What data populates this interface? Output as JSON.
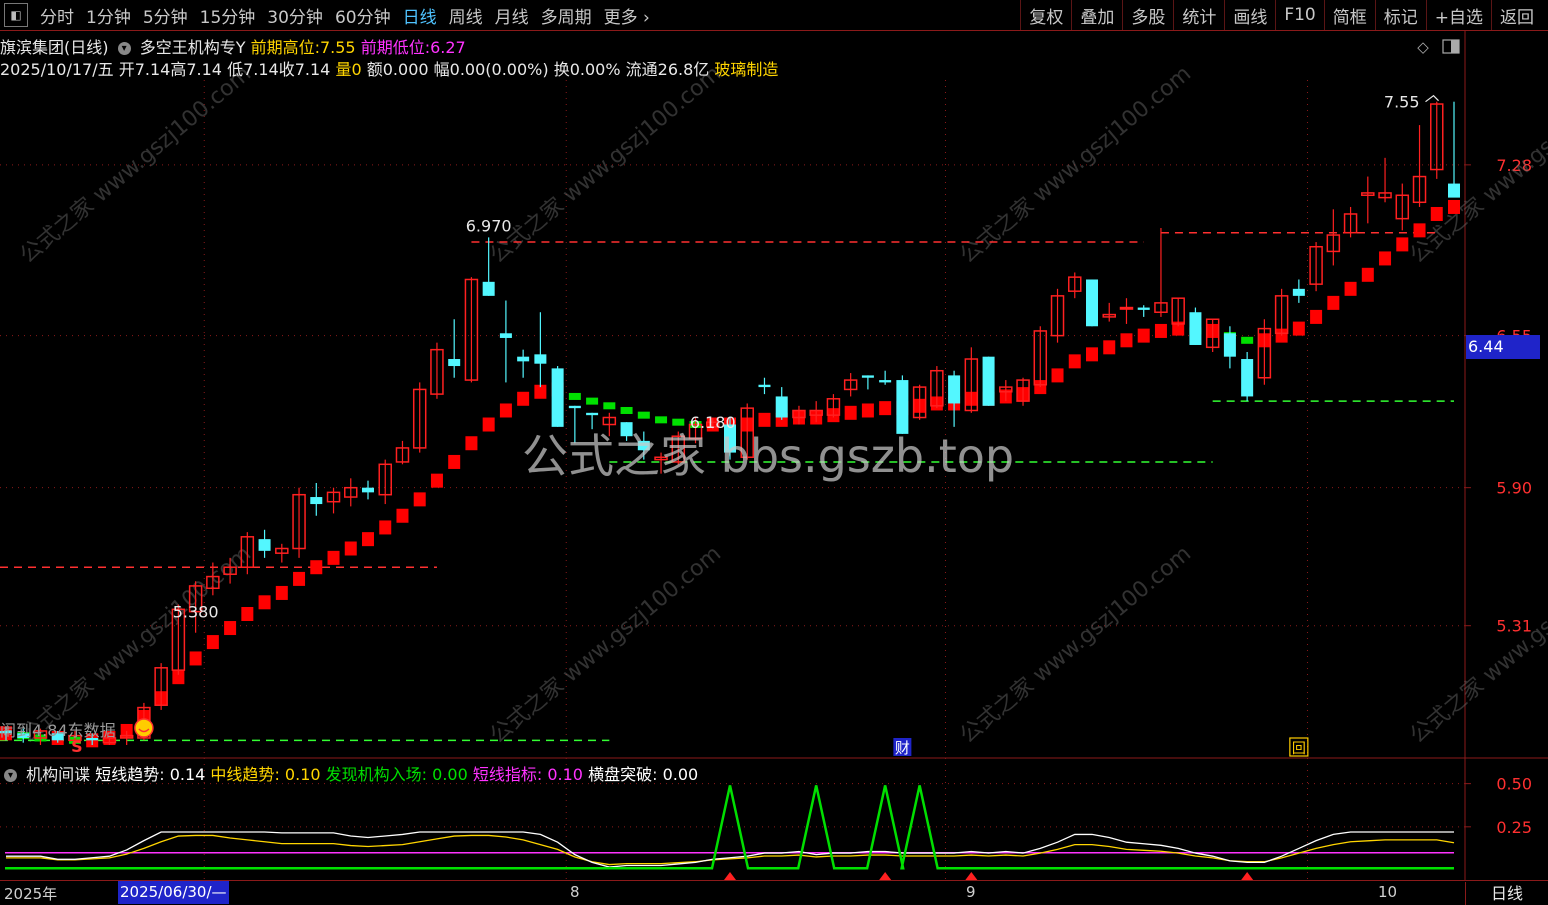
{
  "topbar": {
    "menu_icon": "menu-icon",
    "periods": [
      {
        "label": "分时",
        "active": false
      },
      {
        "label": "1分钟",
        "active": false
      },
      {
        "label": "5分钟",
        "active": false
      },
      {
        "label": "15分钟",
        "active": false
      },
      {
        "label": "30分钟",
        "active": false
      },
      {
        "label": "60分钟",
        "active": false
      },
      {
        "label": "日线",
        "active": true
      },
      {
        "label": "周线",
        "active": false
      },
      {
        "label": "月线",
        "active": false
      },
      {
        "label": "多周期",
        "active": false
      },
      {
        "label": "更多",
        "active": false
      }
    ],
    "tools": [
      "复权",
      "叠加",
      "多股",
      "统计",
      "画线",
      "F10",
      "简框",
      "标记",
      "+自选",
      "返回"
    ]
  },
  "header": {
    "stock": "旗滨集团(日线)",
    "indicator": "多空王机构专Y",
    "prev_high_label": "前期高位:",
    "prev_high_value": "7.55",
    "prev_low_label": "前期低位:",
    "prev_low_value": "6.27"
  },
  "quote": {
    "date": "2025/10/17/五",
    "open": "开7.14",
    "high": "高7.14",
    "low": "低7.14",
    "close": "收7.14",
    "volume": "量0",
    "amount": "额0.000",
    "change": "幅0.00(0.00%)",
    "turnover": "换0.00%",
    "float": "流通26.8亿",
    "sector": "玻璃制造"
  },
  "chart_data": [
    {
      "type": "candlestick",
      "title": "旗滨集团(日线)",
      "yaxis_ticks": [
        "7.28",
        "6.55",
        "5.90",
        "5.31"
      ],
      "current_price": "6.44",
      "annotations": [
        "7.55",
        "6.970",
        "6.180",
        "5.380",
        "4.84"
      ],
      "markers": {
        "start": "S",
        "finance": "财",
        "box": "回"
      },
      "overlay_text": "闹到4.84东数据",
      "candles": [
        [
          4.86,
          4.88,
          4.82,
          4.85
        ],
        [
          4.85,
          4.87,
          4.81,
          4.83
        ],
        [
          4.83,
          4.87,
          4.8,
          4.86
        ],
        [
          4.85,
          4.86,
          4.81,
          4.82
        ],
        [
          4.82,
          4.86,
          4.8,
          4.84
        ],
        [
          4.83,
          4.85,
          4.8,
          4.82
        ],
        [
          4.81,
          4.84,
          4.8,
          4.83
        ],
        [
          4.83,
          4.86,
          4.8,
          4.84
        ],
        [
          4.83,
          4.98,
          4.82,
          4.96
        ],
        [
          4.97,
          5.15,
          4.95,
          5.13
        ],
        [
          5.12,
          5.4,
          5.1,
          5.38
        ],
        [
          5.37,
          5.5,
          5.28,
          5.48
        ],
        [
          5.47,
          5.58,
          5.44,
          5.52
        ],
        [
          5.53,
          5.6,
          5.49,
          5.56
        ],
        [
          5.56,
          5.71,
          5.53,
          5.69
        ],
        [
          5.68,
          5.72,
          5.6,
          5.63
        ],
        [
          5.62,
          5.66,
          5.58,
          5.64
        ],
        [
          5.64,
          5.9,
          5.6,
          5.87
        ],
        [
          5.86,
          5.92,
          5.78,
          5.83
        ],
        [
          5.84,
          5.9,
          5.79,
          5.88
        ],
        [
          5.86,
          5.94,
          5.82,
          5.9
        ],
        [
          5.9,
          5.93,
          5.85,
          5.88
        ],
        [
          5.87,
          6.02,
          5.83,
          6.0
        ],
        [
          6.01,
          6.1,
          6.0,
          6.07
        ],
        [
          6.07,
          6.35,
          6.05,
          6.32
        ],
        [
          6.3,
          6.52,
          6.28,
          6.49
        ],
        [
          6.45,
          6.62,
          6.37,
          6.42
        ],
        [
          6.36,
          6.8,
          6.35,
          6.79
        ],
        [
          6.78,
          6.97,
          6.72,
          6.72
        ],
        [
          6.56,
          6.7,
          6.35,
          6.54
        ],
        [
          6.46,
          6.49,
          6.37,
          6.44
        ],
        [
          6.47,
          6.65,
          6.33,
          6.43
        ],
        [
          6.41,
          6.42,
          6.16,
          6.16
        ],
        [
          6.25,
          6.25,
          6.09,
          6.24
        ],
        [
          6.22,
          6.22,
          6.15,
          6.21
        ],
        [
          6.17,
          6.22,
          6.12,
          6.2
        ],
        [
          6.18,
          6.18,
          6.1,
          6.12
        ],
        [
          6.1,
          6.14,
          6.02,
          6.06
        ],
        [
          6.02,
          6.05,
          5.96,
          6.03
        ],
        [
          6.01,
          6.14,
          6.0,
          6.12
        ],
        [
          6.11,
          6.2,
          6.09,
          6.17
        ],
        [
          6.16,
          6.2,
          6.15,
          6.18
        ],
        [
          6.17,
          6.2,
          6.02,
          6.05
        ],
        [
          6.03,
          6.26,
          6.02,
          6.24
        ],
        [
          6.34,
          6.37,
          6.3,
          6.33
        ],
        [
          6.29,
          6.33,
          6.19,
          6.2
        ],
        [
          6.2,
          6.25,
          6.17,
          6.23
        ],
        [
          6.21,
          6.27,
          6.18,
          6.23
        ],
        [
          6.21,
          6.3,
          6.2,
          6.28
        ],
        [
          6.32,
          6.39,
          6.29,
          6.36
        ],
        [
          6.38,
          6.38,
          6.32,
          6.37
        ],
        [
          6.36,
          6.4,
          6.34,
          6.35
        ],
        [
          6.36,
          6.38,
          6.13,
          6.13
        ],
        [
          6.2,
          6.34,
          6.19,
          6.33
        ],
        [
          6.25,
          6.42,
          6.24,
          6.4
        ],
        [
          6.38,
          6.4,
          6.16,
          6.26
        ],
        [
          6.23,
          6.5,
          6.22,
          6.45
        ],
        [
          6.46,
          6.46,
          6.25,
          6.25
        ],
        [
          6.31,
          6.36,
          6.27,
          6.33
        ],
        [
          6.27,
          6.37,
          6.25,
          6.36
        ],
        [
          6.34,
          6.59,
          6.33,
          6.57
        ],
        [
          6.55,
          6.75,
          6.52,
          6.72
        ],
        [
          6.74,
          6.82,
          6.71,
          6.8
        ],
        [
          6.79,
          6.79,
          6.59,
          6.59
        ],
        [
          6.63,
          6.69,
          6.61,
          6.64
        ],
        [
          6.67,
          6.71,
          6.6,
          6.67
        ],
        [
          6.67,
          6.68,
          6.63,
          6.66
        ],
        [
          6.65,
          7.01,
          6.63,
          6.69
        ],
        [
          6.6,
          6.71,
          6.59,
          6.71
        ],
        [
          6.65,
          6.67,
          6.51,
          6.51
        ],
        [
          6.5,
          6.62,
          6.48,
          6.62
        ],
        [
          6.56,
          6.59,
          6.41,
          6.46
        ],
        [
          6.45,
          6.48,
          6.27,
          6.29
        ],
        [
          6.37,
          6.62,
          6.34,
          6.58
        ],
        [
          6.56,
          6.75,
          6.55,
          6.72
        ],
        [
          6.75,
          6.79,
          6.69,
          6.72
        ],
        [
          6.77,
          6.95,
          6.74,
          6.93
        ],
        [
          6.91,
          7.09,
          6.85,
          6.98
        ],
        [
          6.99,
          7.1,
          6.97,
          7.07
        ],
        [
          7.15,
          7.23,
          7.03,
          7.16
        ],
        [
          7.14,
          7.31,
          7.12,
          7.16
        ],
        [
          7.05,
          7.2,
          7.0,
          7.15
        ],
        [
          7.12,
          7.45,
          7.1,
          7.23
        ],
        [
          7.26,
          7.55,
          7.22,
          7.54
        ],
        [
          7.2,
          7.55,
          7.18,
          7.14
        ]
      ],
      "trend_line": [
        4.85,
        4.84,
        4.83,
        4.83,
        4.82,
        4.82,
        4.83,
        4.86,
        4.92,
        5.0,
        5.09,
        5.17,
        5.24,
        5.3,
        5.36,
        5.41,
        5.45,
        5.51,
        5.56,
        5.6,
        5.64,
        5.68,
        5.73,
        5.78,
        5.85,
        5.93,
        6.01,
        6.09,
        6.17,
        6.23,
        6.28,
        6.31,
        6.32,
        6.29,
        6.27,
        6.25,
        6.23,
        6.21,
        6.19,
        6.18,
        6.17,
        6.17,
        6.17,
        6.17,
        6.19,
        6.19,
        6.2,
        6.2,
        6.21,
        6.22,
        6.23,
        6.24,
        6.24,
        6.25,
        6.26,
        6.26,
        6.28,
        6.28,
        6.29,
        6.3,
        6.33,
        6.38,
        6.44,
        6.47,
        6.5,
        6.53,
        6.55,
        6.57,
        6.58,
        6.57,
        6.57,
        6.55,
        6.53,
        6.53,
        6.55,
        6.58,
        6.63,
        6.69,
        6.75,
        6.81,
        6.88,
        6.94,
        7.0,
        7.07,
        7.1
      ],
      "ylim": [
        4.8,
        7.6
      ]
    },
    {
      "type": "line",
      "title": "机构间谍",
      "legend": [
        {
          "name": "短线趋势",
          "value": "0.14",
          "color": "#ffffff"
        },
        {
          "name": "中线趋势",
          "value": "0.10",
          "color": "#ffd500"
        },
        {
          "name": "发现机构入场",
          "value": "0.00",
          "color": "#00e000"
        },
        {
          "name": "短线指标",
          "value": "0.10",
          "color": "#ff33ff"
        },
        {
          "name": "横盘突破",
          "value": "0.00",
          "color": "#ffffff"
        }
      ],
      "yaxis_ticks": [
        "0.50",
        "0.25"
      ],
      "ylim": [
        0,
        0.55
      ],
      "spikes_at": [
        42,
        47,
        51,
        53
      ],
      "arrows_at": [
        42,
        51,
        56,
        72
      ]
    }
  ],
  "xaxis": {
    "labels": [
      "2025年",
      "2025/06/30/—",
      "8",
      "9",
      "10"
    ],
    "period_label": "日线"
  },
  "watermark": "公式之家 bbs.gszb.top",
  "watermark_small": "公式之家 www.gszj100.com",
  "colors": {
    "up": "#ff2020",
    "down": "#53f7ff",
    "ma_up": "#ff0000",
    "ma_down": "#00e000",
    "grid": "#8b1a1a",
    "highlight": "#1f24c9"
  }
}
